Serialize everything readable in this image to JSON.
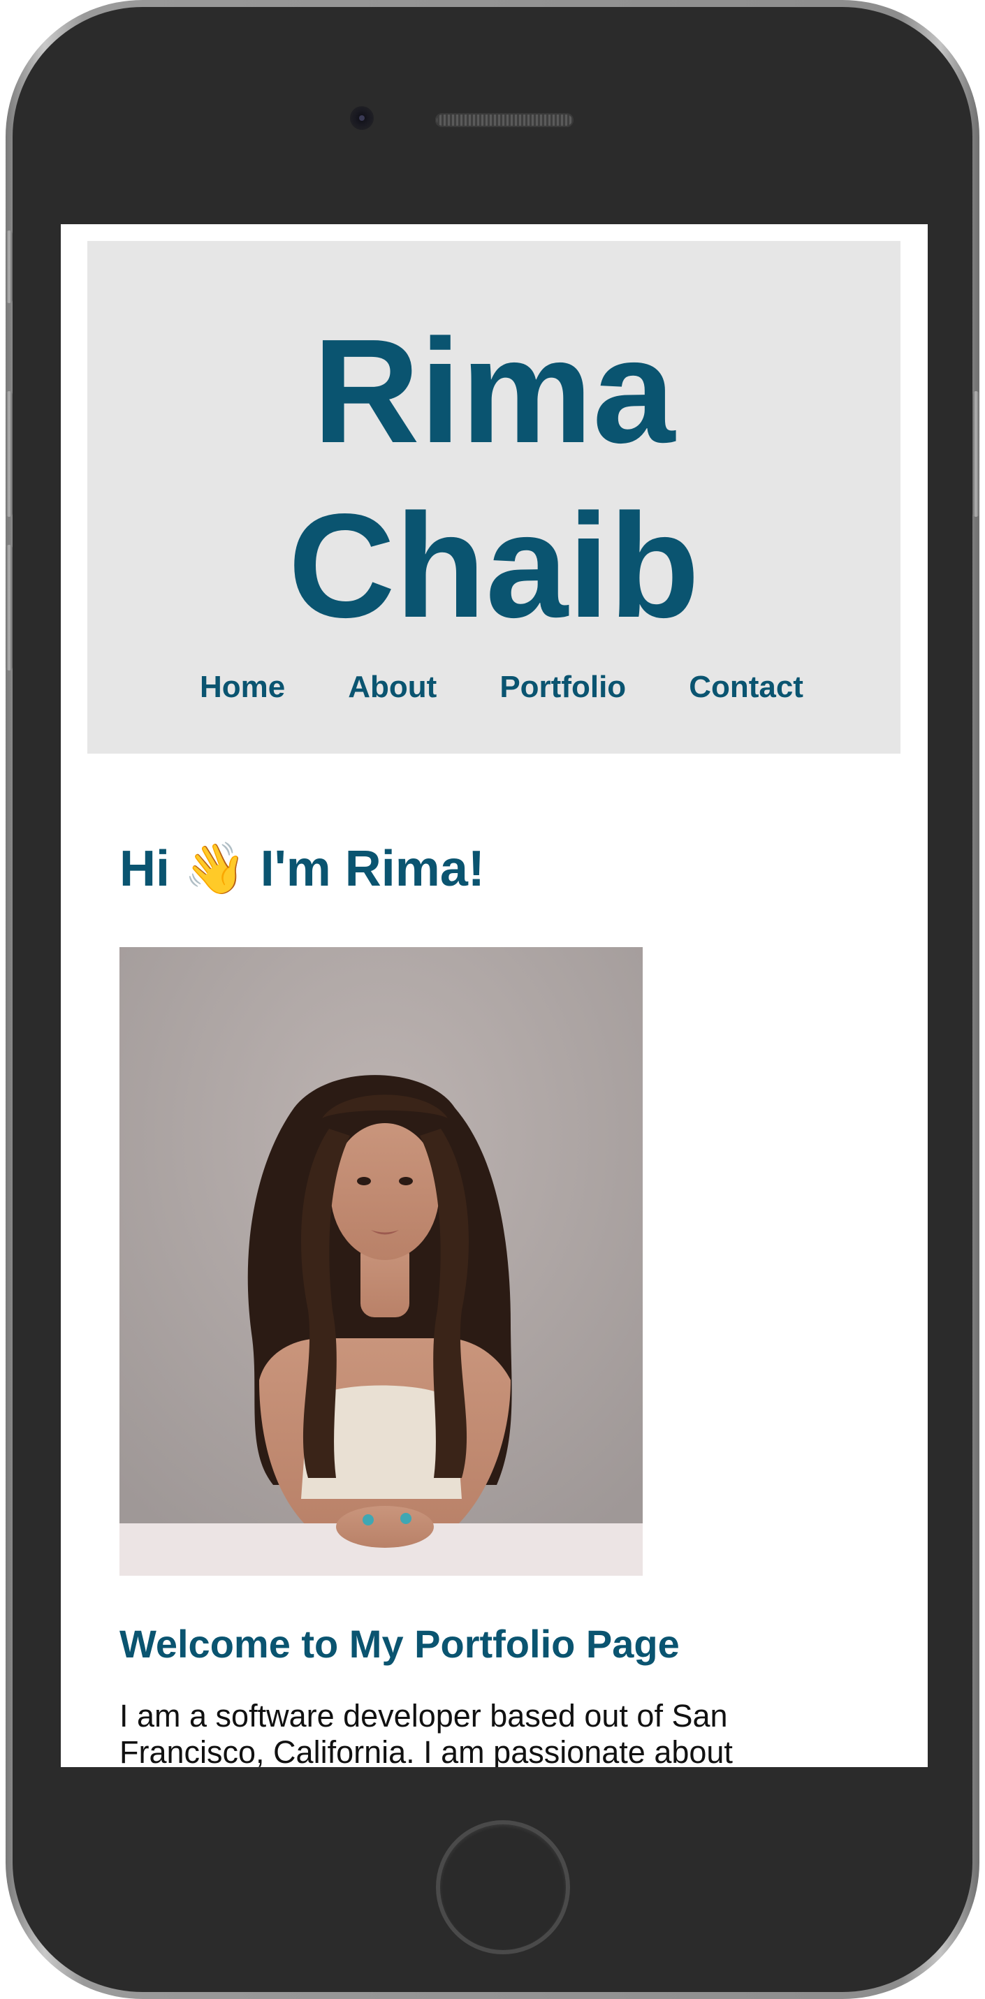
{
  "site": {
    "title_line1": "Rima",
    "title_line2": "Chaib"
  },
  "nav": {
    "items": [
      {
        "label": "Home"
      },
      {
        "label": "About"
      },
      {
        "label": "Portfolio"
      },
      {
        "label": "Contact"
      }
    ]
  },
  "main": {
    "greeting": "Hi 👋 I'm Rima!",
    "welcome_heading": "Welcome to My Portfolio Page",
    "bio_text": "I am a software developer based out of San Francisco, California. I am passionate about"
  },
  "colors": {
    "accent": "#0a5470",
    "header_bg": "#e6e6e6",
    "phone_body": "#2b2b2b",
    "photo_background": "#a9a2a1"
  },
  "icons": {
    "greeting_emoji": "waving-hand-icon"
  }
}
